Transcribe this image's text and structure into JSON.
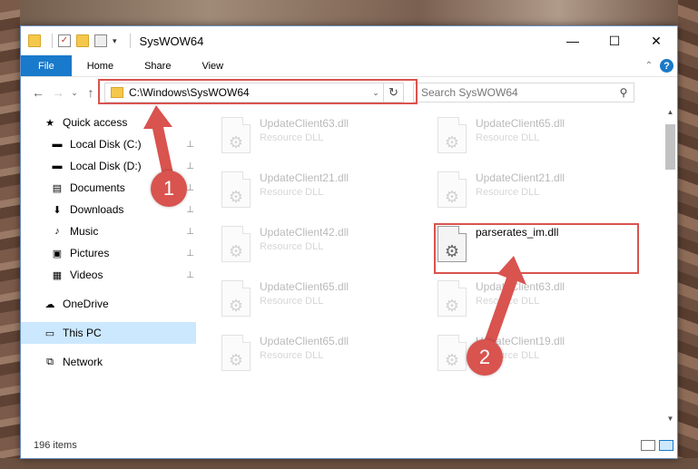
{
  "window": {
    "title": "SysWOW64",
    "minimize": "—",
    "maximize": "☐",
    "close": "✕"
  },
  "ribbon": {
    "tabs": [
      "File",
      "Home",
      "Share",
      "View"
    ],
    "help": "?",
    "collapse": "⌃"
  },
  "nav": {
    "back": "←",
    "forward": "→",
    "recent": "⌄",
    "up": "↑",
    "address": "C:\\Windows\\SysWOW64",
    "address_dropdown": "⌄",
    "refresh": "↻",
    "search_placeholder": "Search SysWOW64",
    "search_glyph": "⚲"
  },
  "sidebar": {
    "items": [
      {
        "label": "Quick access",
        "icon": "star-icon",
        "glyph": "★",
        "pinned": false,
        "selected": false,
        "level": "top"
      },
      {
        "label": "Local Disk (C:)",
        "icon": "drive-icon",
        "glyph": "▬",
        "pinned": true,
        "selected": false,
        "level": "sub"
      },
      {
        "label": "Local Disk (D:)",
        "icon": "drive-icon",
        "glyph": "▬",
        "pinned": true,
        "selected": false,
        "level": "sub"
      },
      {
        "label": "Documents",
        "icon": "documents-icon",
        "glyph": "▤",
        "pinned": true,
        "selected": false,
        "level": "sub"
      },
      {
        "label": "Downloads",
        "icon": "downloads-icon",
        "glyph": "⬇",
        "pinned": true,
        "selected": false,
        "level": "sub"
      },
      {
        "label": "Music",
        "icon": "music-icon",
        "glyph": "♪",
        "pinned": true,
        "selected": false,
        "level": "sub"
      },
      {
        "label": "Pictures",
        "icon": "pictures-icon",
        "glyph": "▣",
        "pinned": true,
        "selected": false,
        "level": "sub"
      },
      {
        "label": "Videos",
        "icon": "videos-icon",
        "glyph": "▦",
        "pinned": true,
        "selected": false,
        "level": "sub"
      },
      {
        "label": "OneDrive",
        "icon": "cloud-icon",
        "glyph": "☁",
        "pinned": false,
        "selected": false,
        "level": "top",
        "gap_before": true
      },
      {
        "label": "This PC",
        "icon": "computer-icon",
        "glyph": "▭",
        "pinned": false,
        "selected": true,
        "level": "top",
        "gap_before": true
      },
      {
        "label": "Network",
        "icon": "network-icon",
        "glyph": "⧉",
        "pinned": false,
        "selected": false,
        "level": "top",
        "gap_before": true
      }
    ],
    "pin_glyph": "📌"
  },
  "files": [
    {
      "name": "UpdateClient63.dll",
      "type": "Resource DLL",
      "faded": true
    },
    {
      "name": "UpdateClient65.dll",
      "type": "Resource DLL",
      "faded": true
    },
    {
      "name": "UpdateClient21.dll",
      "type": "Resource DLL",
      "faded": true
    },
    {
      "name": "UpdateClient21.dll",
      "type": "Resource DLL",
      "faded": true
    },
    {
      "name": "UpdateClient42.dll",
      "type": "Resource DLL",
      "faded": true
    },
    {
      "name": "parserates_im.dll",
      "type": "",
      "faded": false
    },
    {
      "name": "UpdateClient65.dll",
      "type": "Resource DLL",
      "faded": true
    },
    {
      "name": "UpdateClient63.dll",
      "type": "Resource DLL",
      "faded": true
    },
    {
      "name": "UpdateClient65.dll",
      "type": "Resource DLL",
      "faded": true
    },
    {
      "name": "UpdateClient19.dll",
      "type": "Resource DLL",
      "faded": true
    }
  ],
  "file_glyph": "⚙",
  "status": {
    "item_count": "196 items"
  },
  "annotations": {
    "step1": "1",
    "step2": "2",
    "color": "#d9534f"
  }
}
